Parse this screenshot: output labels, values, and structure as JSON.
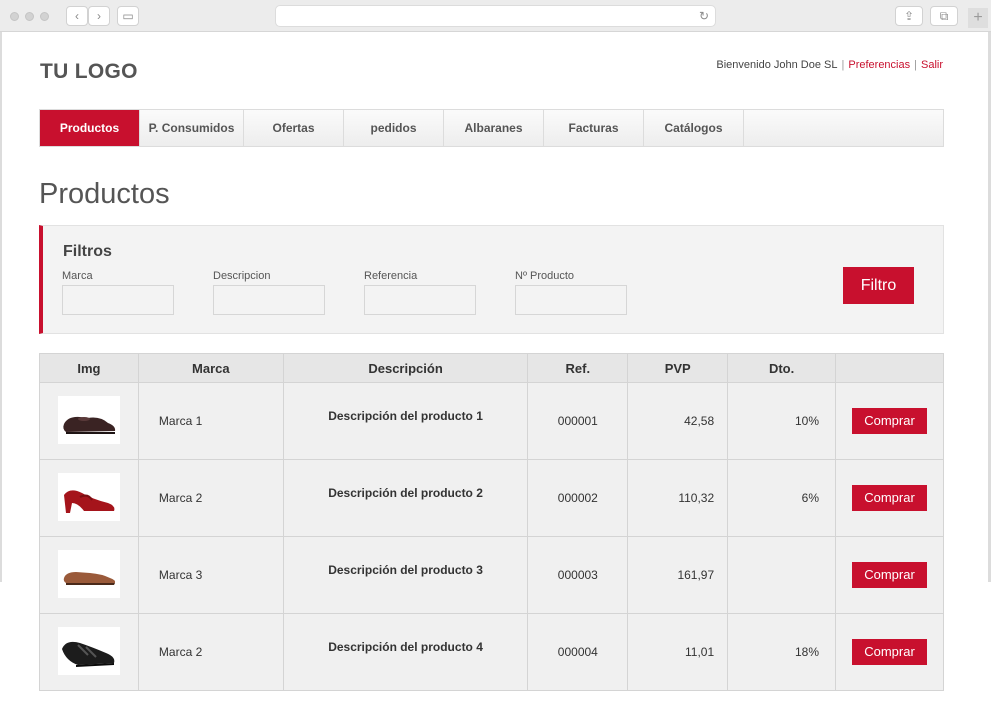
{
  "browser": {
    "reload_glyph": "↻",
    "back_glyph": "‹",
    "forward_glyph": "›",
    "sidebar_glyph": "▭",
    "share_glyph": "⇪",
    "tabs_glyph": "⧉",
    "new_tab_glyph": "+"
  },
  "header": {
    "logo": "TU LOGO",
    "welcome": "Bienvenido John Doe SL",
    "separator": "|",
    "preferences": "Preferencias",
    "logout": "Salir"
  },
  "nav": {
    "items": [
      {
        "label": "Productos"
      },
      {
        "label": "P. Consumidos"
      },
      {
        "label": "Ofertas"
      },
      {
        "label": "pedidos"
      },
      {
        "label": "Albaranes"
      },
      {
        "label": "Facturas"
      },
      {
        "label": "Catálogos"
      }
    ]
  },
  "page": {
    "title": "Productos"
  },
  "filters": {
    "title": "Filtros",
    "fields": [
      {
        "label": "Marca",
        "value": ""
      },
      {
        "label": "Descripcion",
        "value": ""
      },
      {
        "label": "Referencia",
        "value": ""
      },
      {
        "label": "Nº Producto",
        "value": ""
      }
    ],
    "button": "Filtro"
  },
  "table": {
    "headers": [
      "Img",
      "Marca",
      "Descripción",
      "Ref.",
      "PVP",
      "Dto.",
      ""
    ],
    "rows": [
      {
        "marca": "Marca 1",
        "descripcion": "Descripción del producto 1",
        "ref": "000001",
        "pvp": "42,58",
        "dto": "10%",
        "buy": "Comprar"
      },
      {
        "marca": "Marca 2",
        "descripcion": "Descripción del producto 2",
        "ref": "000002",
        "pvp": "110,32",
        "dto": "6%",
        "buy": "Comprar"
      },
      {
        "marca": "Marca 3",
        "descripcion": "Descripción del producto 3",
        "ref": "000003",
        "pvp": "161,97",
        "dto": "",
        "buy": "Comprar"
      },
      {
        "marca": "Marca 2",
        "descripcion": "Descripción del producto 4",
        "ref": "000004",
        "pvp": "11,01",
        "dto": "18%",
        "buy": "Comprar"
      }
    ]
  },
  "colors": {
    "accent": "#c8102e",
    "text": "#333333",
    "panel": "#f3f3f3"
  }
}
